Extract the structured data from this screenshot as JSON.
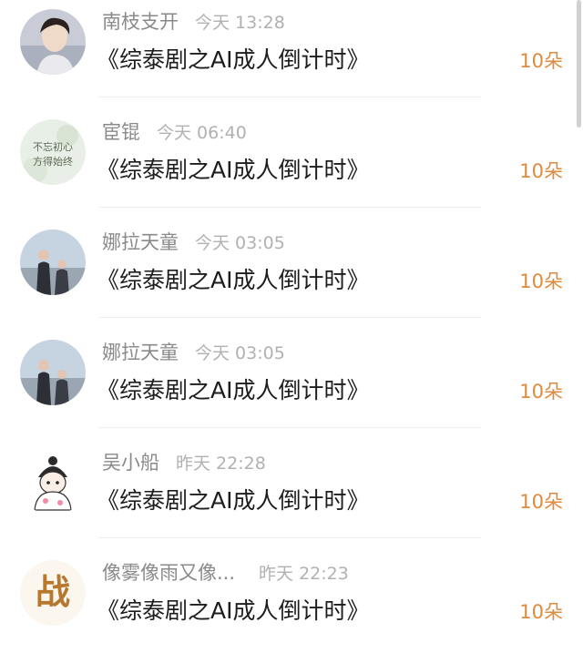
{
  "items": [
    {
      "name": "南枝支开",
      "time": "今天 13:28",
      "title": "《综泰剧之AI成人倒计时》",
      "count": "10朵",
      "avatar": "portrait-avatar"
    },
    {
      "name": "宦锟",
      "time": "今天 06:40",
      "title": "《综泰剧之AI成人倒计时》",
      "count": "10朵",
      "avatar": "calligraphy-avatar"
    },
    {
      "name": "娜拉天童",
      "time": "今天 03:05",
      "title": "《综泰剧之AI成人倒计时》",
      "count": "10朵",
      "avatar": "couple-photo-avatar"
    },
    {
      "name": "娜拉天童",
      "time": "今天 03:05",
      "title": "《综泰剧之AI成人倒计时》",
      "count": "10朵",
      "avatar": "couple-photo-avatar"
    },
    {
      "name": "吴小船",
      "time": "昨天 22:28",
      "title": "《综泰剧之AI成人倒计时》",
      "count": "10朵",
      "avatar": "cartoon-avatar"
    },
    {
      "name": "像雾像雨又像...",
      "time": "昨天 22:23",
      "title": "《综泰剧之AI成人倒计时》",
      "count": "10朵",
      "avatar": "zhan-logo-avatar"
    }
  ],
  "avatar_logo_text": "战",
  "avatar_calligraphy_text": [
    "不忘初心",
    "方得始终"
  ],
  "colors": {
    "count": "#e08a3c",
    "name": "#8a8a8a",
    "time": "#b1b1b1",
    "title": "#1d1d1d"
  }
}
